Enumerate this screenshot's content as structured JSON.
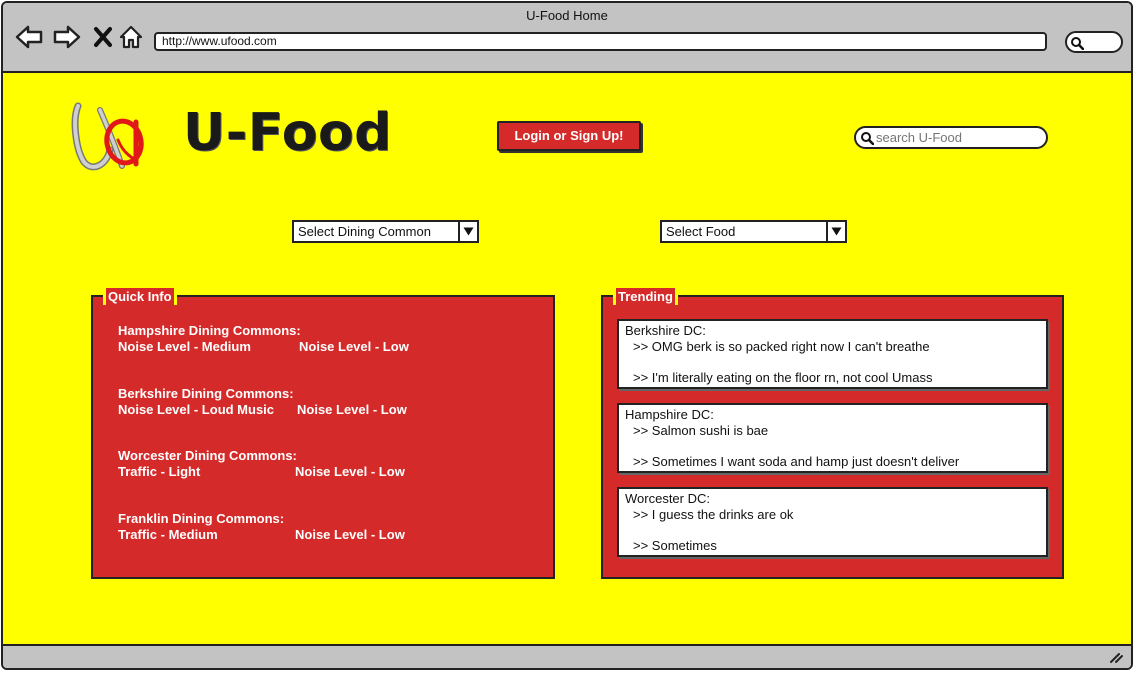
{
  "window": {
    "title": "U-Food Home"
  },
  "browser": {
    "url": "http://www.ufood.com",
    "nav_icons": [
      "back-icon",
      "forward-icon",
      "close-icon",
      "home-icon"
    ],
    "search_icon": "search-icon"
  },
  "header": {
    "logo_letter": "U",
    "brand": "U-Food",
    "login_label": "Login or Sign Up!",
    "search_placeholder": "search U-Food"
  },
  "selectors": {
    "dining_common": {
      "selected": "Select Dining Common"
    },
    "food": {
      "selected": "Select Food"
    }
  },
  "quick_info": {
    "title": "Quick Info",
    "entries": [
      {
        "name": "Hampshire Dining Commons:",
        "left": "Noise Level - Medium",
        "right": "Noise Level - Low"
      },
      {
        "name": "Berkshire Dining Commons:",
        "left": "Noise Level - Loud Music",
        "right": "Noise Level - Low"
      },
      {
        "name": "Worcester Dining Commons:",
        "left": "Traffic - Light",
        "right": "Noise Level - Low"
      },
      {
        "name": "Franklin Dining Commons:",
        "left": "Traffic - Medium",
        "right": "Noise Level - Low"
      }
    ]
  },
  "trending": {
    "title": "Trending",
    "posts": [
      {
        "dc": "Berkshire DC:",
        "lines": [
          ">> OMG berk is so packed right now I can't breathe",
          ">> I'm literally eating on the floor rn, not cool Umass"
        ]
      },
      {
        "dc": "Hampshire DC:",
        "lines": [
          ">> Salmon sushi is bae",
          ">> Sometimes I want soda and hamp just doesn't deliver"
        ]
      },
      {
        "dc": "Worcester DC:",
        "lines": [
          ">>  I guess the drinks are ok",
          ">> Sometimes"
        ]
      }
    ]
  },
  "colors": {
    "background": "#ffff00",
    "panel": "#d52a2a",
    "chrome": "#c3c3c3",
    "logo_red": "#e01818",
    "logo_gray": "#bdbdbd"
  }
}
